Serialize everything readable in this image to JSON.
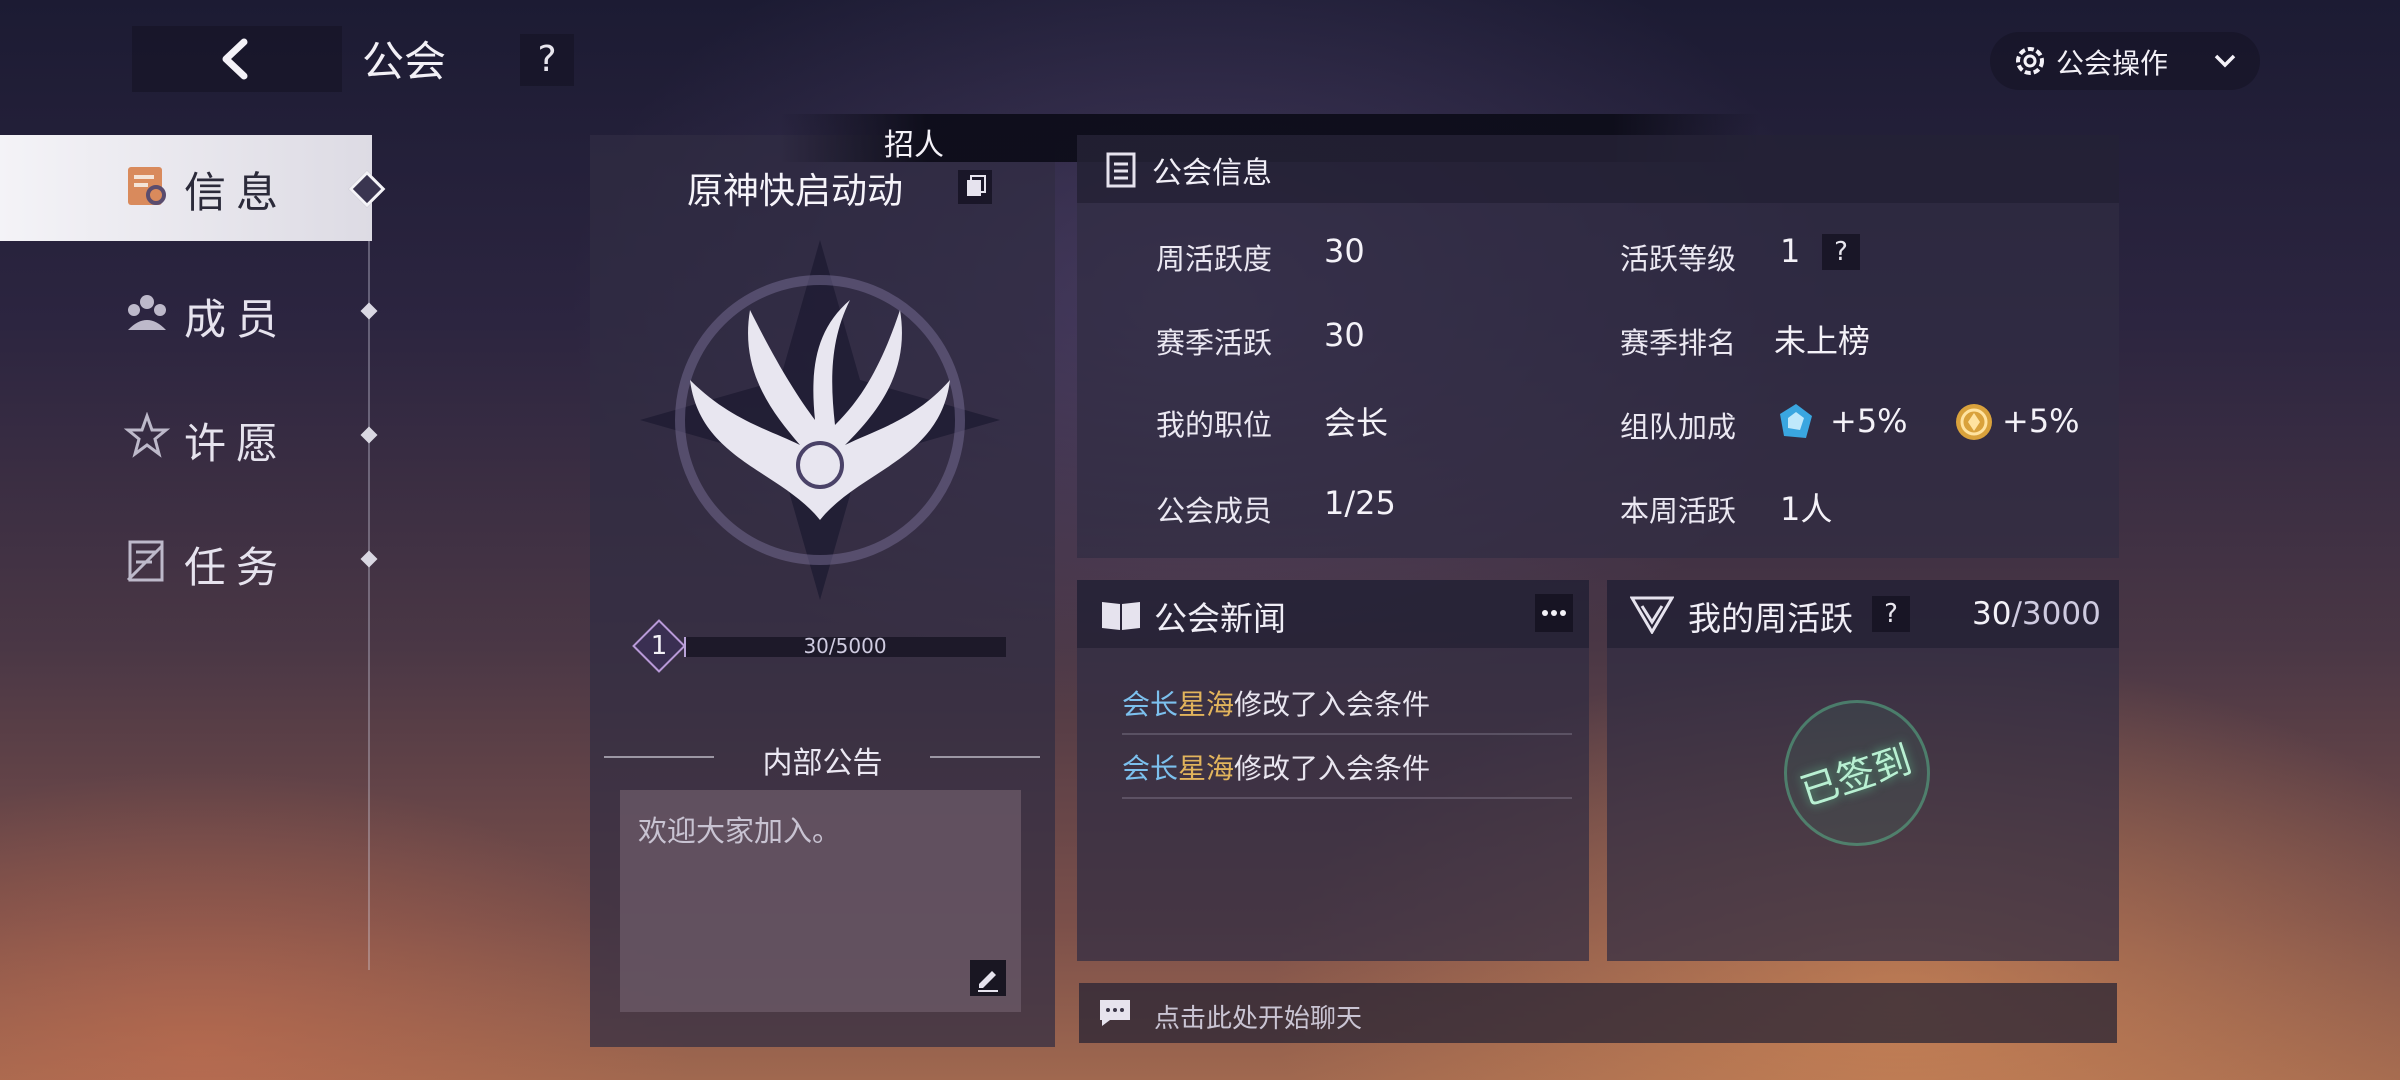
{
  "header": {
    "title": "公会",
    "help_label": "?",
    "ops_label": "公会操作"
  },
  "sidebar": {
    "items": [
      {
        "label": "信息",
        "icon": "info-icon",
        "active": true
      },
      {
        "label": "成员",
        "icon": "members-icon",
        "active": false
      },
      {
        "label": "许愿",
        "icon": "wish-icon",
        "active": false
      },
      {
        "label": "任务",
        "icon": "task-icon",
        "active": false
      }
    ]
  },
  "guild": {
    "recruit_label": "招人",
    "name": "原神快启动动",
    "level": "1",
    "exp_text": "30/5000",
    "exp_fraction": 0.006,
    "notice_title": "内部公告",
    "notice_text": "欢迎大家加入。"
  },
  "info": {
    "title": "公会信息",
    "rows": [
      {
        "label": "周活跃度",
        "value": "30"
      },
      {
        "label": "赛季活跃",
        "value": "30"
      },
      {
        "label": "我的职位",
        "value": "会长"
      },
      {
        "label": "公会成员",
        "value": "1/25"
      }
    ],
    "rows_right": [
      {
        "label": "活跃等级",
        "value": "1"
      },
      {
        "label": "赛季排名",
        "value": "未上榜"
      },
      {
        "label": "组队加成",
        "value": ""
      },
      {
        "label": "本周活跃",
        "value": "1人"
      }
    ],
    "bonus": [
      {
        "icon": "blue-crystal-icon",
        "value": "+5%"
      },
      {
        "icon": "gold-coin-icon",
        "value": "+5%"
      }
    ],
    "help_label": "?"
  },
  "news": {
    "title": "公会新闻",
    "items": [
      {
        "role": "会长",
        "name": "星海",
        "text": "修改了入会条件"
      },
      {
        "role": "会长",
        "name": "星海",
        "text": "修改了入会条件"
      }
    ]
  },
  "weekly": {
    "title": "我的周活跃",
    "help_label": "?",
    "current": "30",
    "total": "/3000",
    "stamp": "已签到"
  },
  "chat": {
    "placeholder": "点击此处开始聊天"
  },
  "colors": {
    "accent_blue": "#7cc0ee",
    "accent_gold": "#e2b45c",
    "signed_green": "#b8f0d2"
  }
}
